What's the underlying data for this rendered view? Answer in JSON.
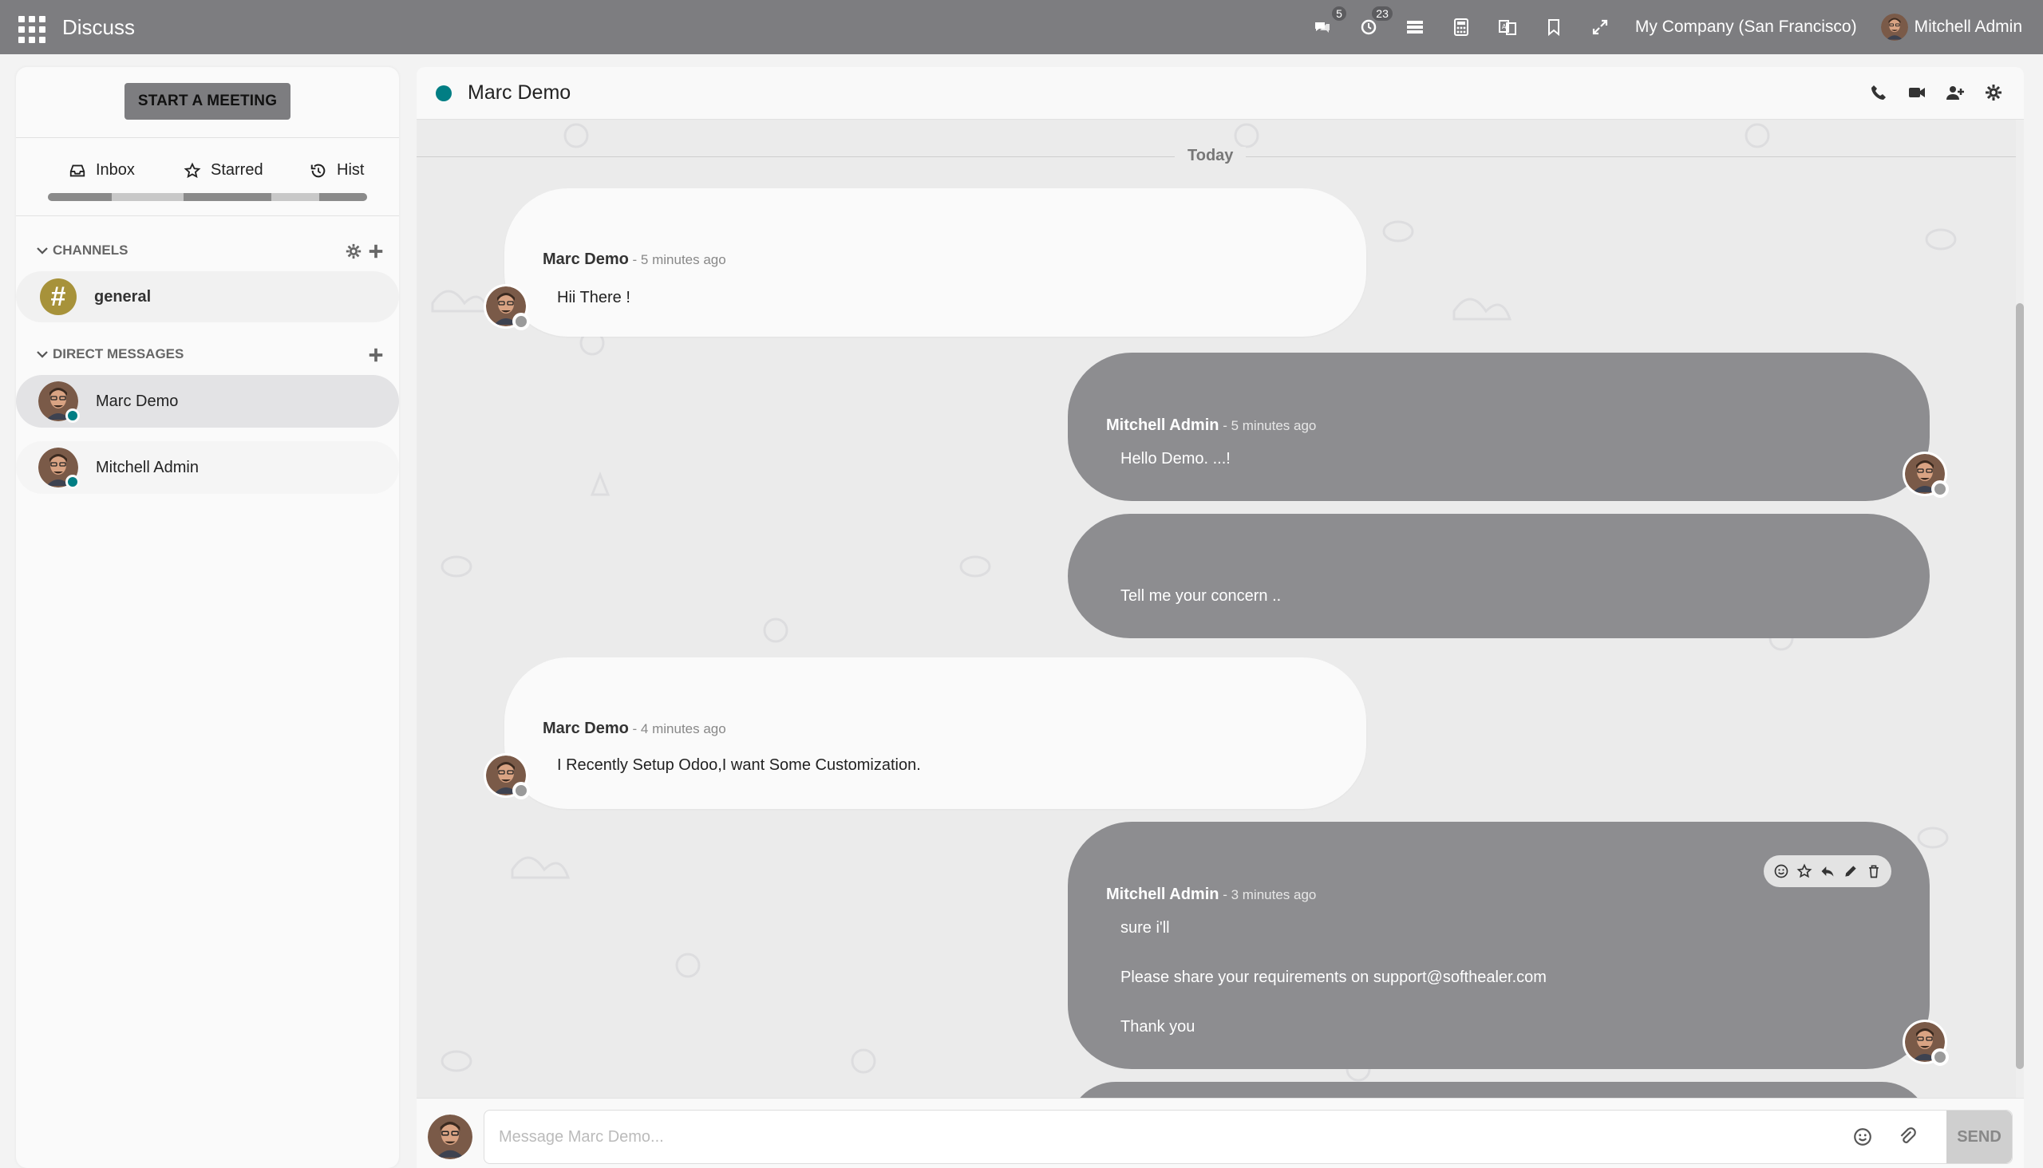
{
  "app": {
    "title": "Discuss",
    "company": "My Company (San Francisco)",
    "user_name": "Mitchell Admin",
    "messages_badge": "5",
    "activities_badge": "23"
  },
  "sidebar": {
    "start_meeting": "START A MEETING",
    "mailboxes": [
      {
        "label": "Inbox",
        "icon": "inbox-icon"
      },
      {
        "label": "Starred",
        "icon": "star-icon"
      },
      {
        "label": "Hist",
        "icon": "history-icon"
      }
    ],
    "channels_header": "CHANNELS",
    "channels": [
      {
        "name": "general"
      }
    ],
    "dm_header": "DIRECT MESSAGES",
    "direct_messages": [
      {
        "name": "Marc Demo",
        "active": true
      },
      {
        "name": "Mitchell Admin",
        "active": false
      }
    ]
  },
  "thread": {
    "name": "Marc Demo",
    "date_separator": "Today",
    "messages": [
      {
        "author": "Marc Demo",
        "time": " - 5 minutes ago",
        "lines": [
          "Hii There !"
        ]
      },
      {
        "author": "Mitchell Admin",
        "time": " - 5 minutes ago",
        "lines": [
          "Hello Demo. ...!"
        ]
      },
      {
        "author": "",
        "time": "",
        "lines": [
          "Tell me your concern .."
        ]
      },
      {
        "author": "Marc Demo",
        "time": " - 4 minutes ago",
        "lines": [
          "I Recently Setup Odoo,I want Some Customization."
        ]
      },
      {
        "author": "Mitchell Admin",
        "time": " - 3 minutes ago",
        "lines": [
          "sure i'll",
          "Please share your requirements on support@softhealer.com",
          "Thank you"
        ]
      }
    ]
  },
  "composer": {
    "placeholder": "Message Marc Demo...",
    "send_label": "SEND"
  },
  "colors": {
    "navbar": "#7d7d80",
    "accent_teal": "#017e84",
    "channel_avatar": "#a7923a",
    "outgoing_bubble": "#8d8d90"
  }
}
